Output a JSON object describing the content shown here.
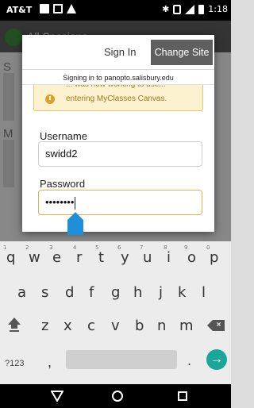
{
  "status_bar": {
    "carrier": "AT&T",
    "time": "1:18"
  },
  "background_app": {
    "title": "All Sessions",
    "letters": [
      "S",
      "M"
    ]
  },
  "dialog": {
    "title": "Sign In",
    "change_site_label": "Change Site",
    "signing_in_to": "Signing in to panopto.salisbury.edu",
    "notice_line1": "... was now working to use...",
    "notice_line2": "entering MyClasses Canvas.",
    "username_label": "Username",
    "username_value": "swidd2",
    "password_label": "Password",
    "password_value": "••••••••"
  },
  "keyboard": {
    "row1": [
      "q",
      "w",
      "e",
      "r",
      "t",
      "y",
      "u",
      "i",
      "o",
      "p"
    ],
    "row1_hints": [
      "1",
      "2",
      "3",
      "4",
      "5",
      "6",
      "7",
      "8",
      "9",
      "0"
    ],
    "row2": [
      "a",
      "s",
      "d",
      "f",
      "g",
      "h",
      "j",
      "k",
      "l"
    ],
    "row3": [
      "z",
      "x",
      "c",
      "v",
      "b",
      "n",
      "m"
    ],
    "symbols_label": "?123",
    "comma": ",",
    "period": "."
  },
  "icons": {
    "shift": "shift-icon",
    "backspace": "backspace-icon",
    "go": "go-arrow-icon",
    "nav_back": "back-icon",
    "nav_home": "home-icon",
    "nav_recent": "recent-apps-icon"
  },
  "colors": {
    "accent": "#1e8fd8",
    "go_button": "#1aa79a",
    "notice_bg": "#fcf2d0",
    "change_site_bg": "#5f5f5f"
  }
}
